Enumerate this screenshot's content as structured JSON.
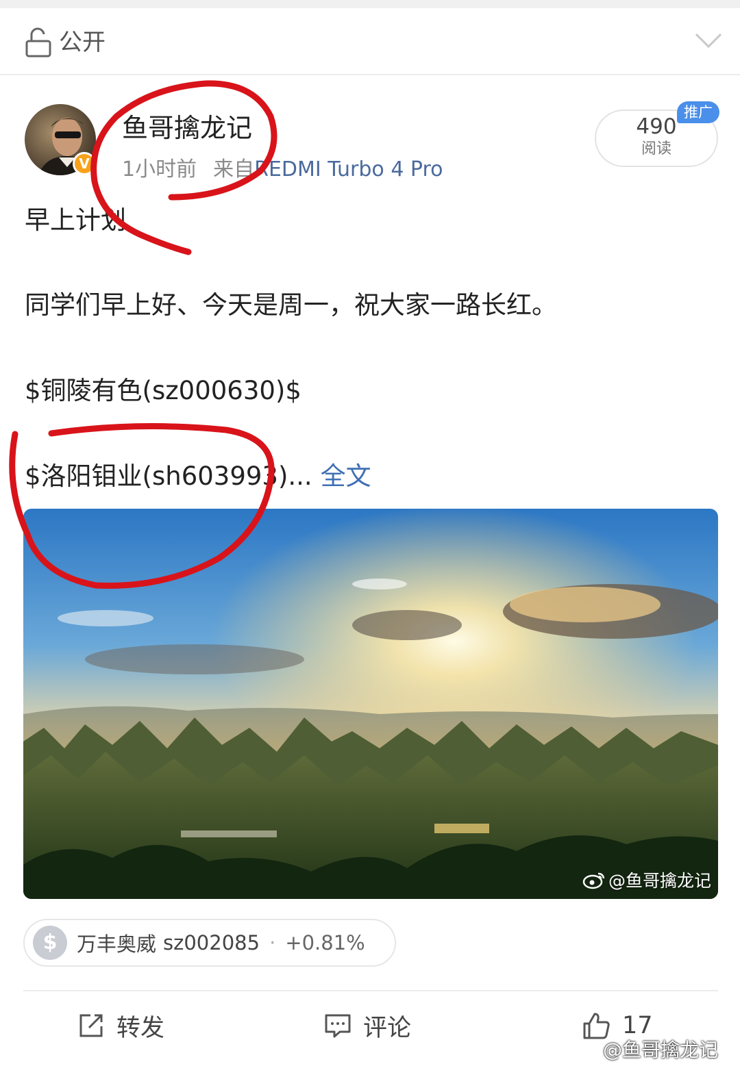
{
  "visibility": {
    "label": "公开"
  },
  "author": {
    "name": "鱼哥擒龙记",
    "time": "1小时前",
    "source_prefix": "来自",
    "source": "REDMI Turbo 4 Pro",
    "verified_mark": "V"
  },
  "reads": {
    "count": "490",
    "label": "阅读",
    "badge": "推广"
  },
  "post": {
    "title": "早上计划",
    "line1": "同学们早上好、今天是周一，祝大家一路长红。",
    "line2": "$铜陵有色(sz000630)$",
    "line3": "$洛阳钼业(sh603993)...",
    "more": "全文"
  },
  "image": {
    "watermark": "@鱼哥擒龙记"
  },
  "stock_chip": {
    "symbol": "$",
    "name": "万丰奥威",
    "code": "sz002085",
    "separator": "·",
    "change": "+0.81%"
  },
  "actions": {
    "repost": "转发",
    "comment": "评论",
    "like_count": "17"
  },
  "footer_watermark": "@鱼哥擒龙记",
  "colors": {
    "link": "#3e6fb3",
    "promo": "#4a8fea",
    "annotation": "#d8141a",
    "verified": "#f7a21b"
  }
}
